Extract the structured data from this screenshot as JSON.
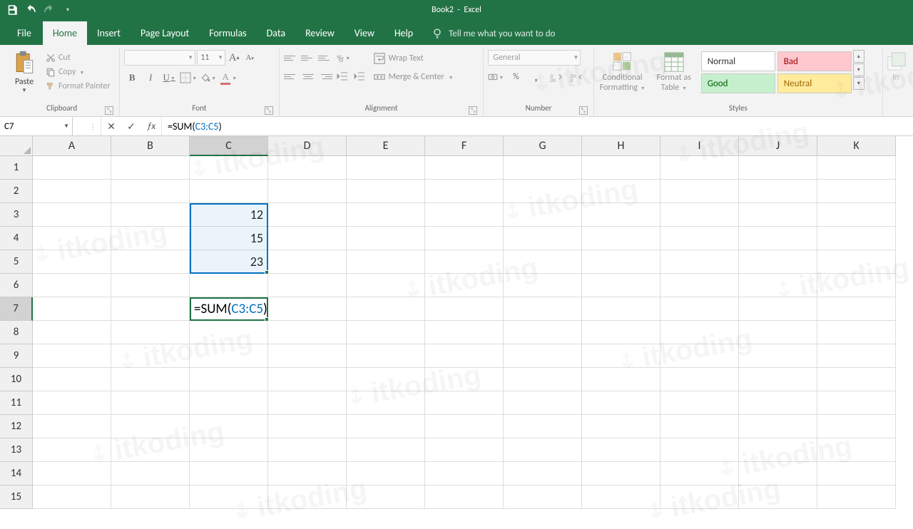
{
  "title": {
    "book": "Book2",
    "app": "Excel"
  },
  "tabs": [
    "File",
    "Home",
    "Insert",
    "Page Layout",
    "Formulas",
    "Data",
    "Review",
    "View",
    "Help"
  ],
  "tellme": "Tell me what you want to do",
  "clipboard": {
    "paste": "Paste",
    "cut": "Cut",
    "copy": "Copy",
    "fp": "Format Painter",
    "label": "Clipboard"
  },
  "font": {
    "size": "11",
    "label": "Font"
  },
  "alignment": {
    "wrap": "Wrap Text",
    "merge": "Merge & Center",
    "label": "Alignment"
  },
  "number": {
    "format": "General",
    "label": "Number"
  },
  "cond": {
    "l1": "Conditional",
    "l2": "Formatting"
  },
  "fat": {
    "l1": "Format as",
    "l2": "Table"
  },
  "styles": {
    "normal": "Normal",
    "bad": "Bad",
    "good": "Good",
    "neutral": "Neutral",
    "label": "Styles"
  },
  "namebox": "C7",
  "formula": {
    "pre": "=SUM(",
    "ref": "C3:C5",
    "post": ")"
  },
  "cols": [
    "A",
    "B",
    "C",
    "D",
    "E",
    "F",
    "G",
    "H",
    "I",
    "J",
    "K"
  ],
  "rows": [
    "1",
    "2",
    "3",
    "4",
    "5",
    "6",
    "7",
    "8",
    "9",
    "10",
    "11",
    "12",
    "13",
    "14",
    "15"
  ],
  "cells": {
    "C3": "12",
    "C4": "15",
    "C5": "23"
  },
  "editcell": {
    "pre": "=SUM(",
    "ref": "C3:C5",
    "post": ")"
  },
  "wm": "itkoding",
  "ins": "In"
}
